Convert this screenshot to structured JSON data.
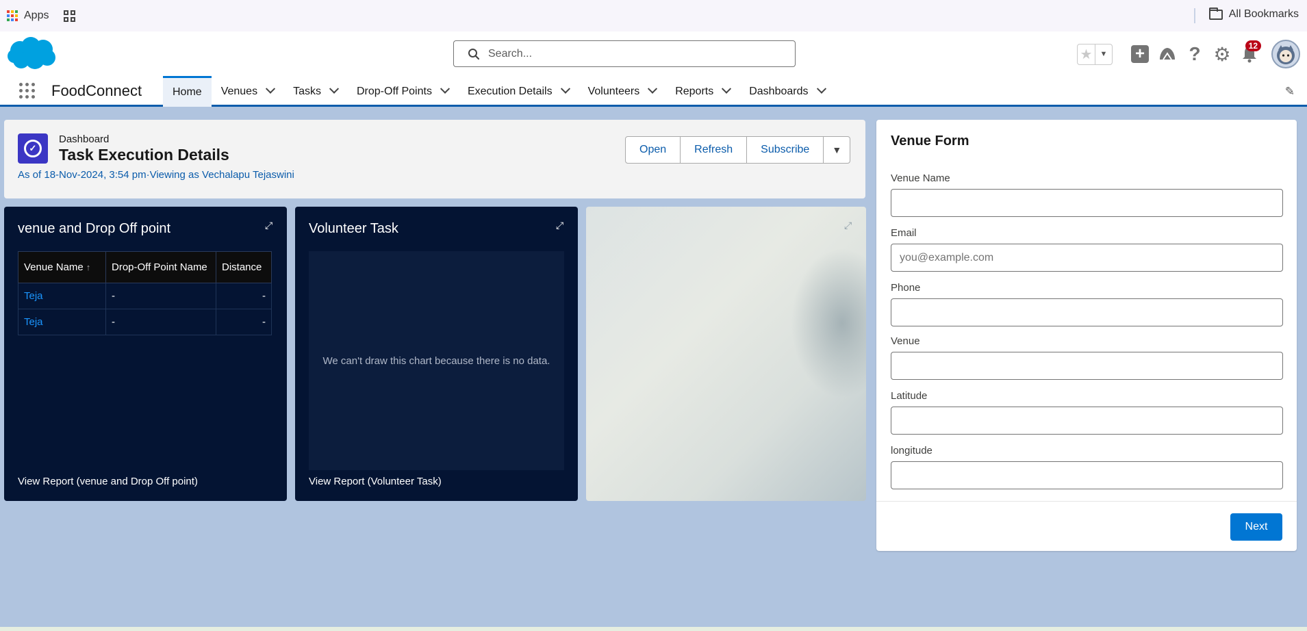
{
  "bookmarks": {
    "apps_label": "Apps",
    "all_bookmarks_label": "All Bookmarks",
    "apps_colors": [
      "#ea4335",
      "#fbbc05",
      "#34a853",
      "#4285f4",
      "#ea4335",
      "#fbbc05",
      "#34a853",
      "#4285f4",
      "#ea4335"
    ]
  },
  "header": {
    "search_placeholder": "Search...",
    "notification_count": "12",
    "brand_color": "#0176d3"
  },
  "nav": {
    "app_name": "FoodConnect",
    "items": [
      {
        "label": "Home",
        "active": true
      },
      {
        "label": "Venues"
      },
      {
        "label": "Tasks"
      },
      {
        "label": "Drop-Off Points"
      },
      {
        "label": "Execution Details"
      },
      {
        "label": "Volunteers"
      },
      {
        "label": "Reports"
      },
      {
        "label": "Dashboards"
      }
    ]
  },
  "dashboard": {
    "kicker": "Dashboard",
    "title": "Task Execution Details",
    "meta": "As of 18-Nov-2024, 3:54 pm·Viewing as Vechalapu Tejaswini",
    "buttons": {
      "open": "Open",
      "refresh": "Refresh",
      "subscribe": "Subscribe"
    }
  },
  "widgets": {
    "venue_table": {
      "title": "venue and Drop Off point",
      "columns": [
        "Venue Name",
        "Drop-Off Point Name",
        "Distance"
      ],
      "rows": [
        [
          "Teja",
          "-",
          "-"
        ],
        [
          "Teja",
          "-",
          "-"
        ]
      ],
      "footer": "View Report (venue and Drop Off point)"
    },
    "volunteer_task": {
      "title": "Volunteer Task",
      "empty_message": "We can't draw this chart because there is no data.",
      "footer": "View Report (Volunteer Task)"
    }
  },
  "venue_form": {
    "title": "Venue Form",
    "fields": [
      {
        "label": "Venue Name",
        "value": "",
        "placeholder": ""
      },
      {
        "label": "Email",
        "value": "",
        "placeholder": "you@example.com"
      },
      {
        "label": "Phone",
        "value": "",
        "placeholder": ""
      },
      {
        "label": "Venue",
        "value": "",
        "placeholder": ""
      },
      {
        "label": "Latitude",
        "value": "",
        "placeholder": ""
      },
      {
        "label": "longitude",
        "value": "",
        "placeholder": ""
      }
    ],
    "next_label": "Next"
  }
}
